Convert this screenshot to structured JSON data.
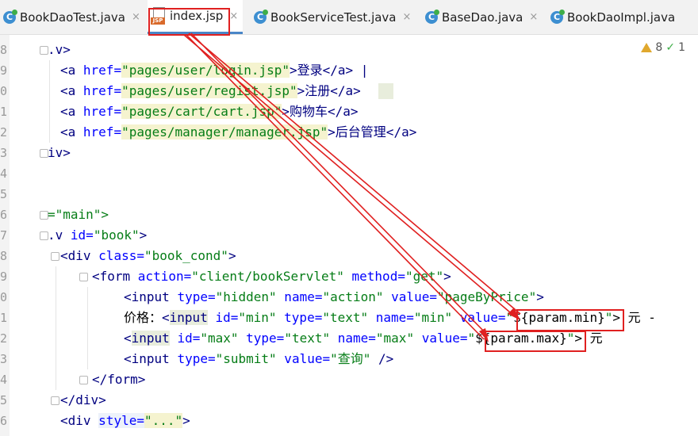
{
  "tabs": [
    {
      "label": "BookDaoTest.java",
      "icon": "java-class-icon",
      "active": false
    },
    {
      "label": "index.jsp",
      "icon": "jsp-file-icon",
      "active": true
    },
    {
      "label": "BookServiceTest.java",
      "icon": "java-class-icon",
      "active": false
    },
    {
      "label": "BaseDao.java",
      "icon": "java-class-icon",
      "active": false
    },
    {
      "label": "BookDaoImpl.java",
      "icon": "java-class-icon",
      "active": false
    }
  ],
  "close_glyph": "×",
  "class_icon_letter": "C",
  "jsp_badge": "JSP",
  "inspections": {
    "warnings": "8",
    "checks": "1"
  },
  "line_numbers": [
    "8",
    "9",
    "0",
    "1",
    "2",
    "3",
    "4",
    "5",
    "6",
    "7",
    "8",
    "9",
    "0",
    "1",
    "2",
    "3",
    "4",
    "5",
    "6"
  ],
  "lines": {
    "l0": {
      "a": ".v>"
    },
    "l1": {
      "a": "<a ",
      "b": "href=",
      "c": "\"pages/user/login.jsp\"",
      "d": ">登录</a> |"
    },
    "l2": {
      "a": "<a ",
      "b": "href=",
      "c": "\"pages/user/regist.jsp\"",
      "d": ">注册</a>"
    },
    "l3": {
      "a": "<a ",
      "b": "href=",
      "c": "\"pages/cart/cart.jsp\"",
      "d": ">购物车</a>"
    },
    "l4": {
      "a": "<a ",
      "b": "href=",
      "c": "\"pages/manager/manager.jsp\"",
      "d": ">后台管理</a>"
    },
    "l5": {
      "a": "iv>"
    },
    "l8": {
      "a": "=\"main\">"
    },
    "l9": {
      "a": ".v ",
      "b": "id=",
      "c": "\"book\"",
      "d": ">"
    },
    "l10": {
      "a": "<div ",
      "b": "class=",
      "c": "\"book_cond\"",
      "d": ">"
    },
    "l11": {
      "a": "<form ",
      "b": "action=",
      "c": "\"client/bookServlet\"",
      "b2": " method=",
      "c2": "\"get\"",
      "d": ">"
    },
    "l12": {
      "a": "<input ",
      "b": "type=",
      "c": "\"hidden\"",
      "b2": " name=",
      "c2": "\"action\"",
      "b3": " value=",
      "c3": "\"pageByPrice\"",
      "d": ">"
    },
    "l13": {
      "pre": "价格：",
      "a": "<",
      "a2": "input",
      "b": " id=",
      "c": "\"min\"",
      "b2": " type=",
      "c2": "\"text\"",
      "b3": " name=",
      "c3": "\"min\"",
      "b4": " value=",
      "c4": "\"",
      "c5": "${param.min}",
      "c6": "\"",
      "d": "> 元 -"
    },
    "l14": {
      "a": "<",
      "a2": "input",
      "b": " id=",
      "c": "\"max\"",
      "b2": " type=",
      "c2": "\"text\"",
      "b3": " name=",
      "c3": "\"max\"",
      "b4": " value=",
      "c4": "\"",
      "c5": "${param.max}",
      "c6": "\"",
      "d": "> 元"
    },
    "l15": {
      "a": "<input ",
      "b": "type=",
      "c": "\"submit\"",
      "b2": " value=",
      "c2": "\"查询\"",
      "d": " />"
    },
    "l16": {
      "a": "</form>"
    },
    "l17": {
      "a": "</div>"
    },
    "l18": {
      "a": "<div ",
      "b": "style=",
      "c": "\"...\"",
      "d": ">"
    }
  },
  "colors": {
    "highlight_box": "#e02020",
    "tag": "#000080",
    "attr": "#0000ff",
    "string": "#067d17"
  }
}
